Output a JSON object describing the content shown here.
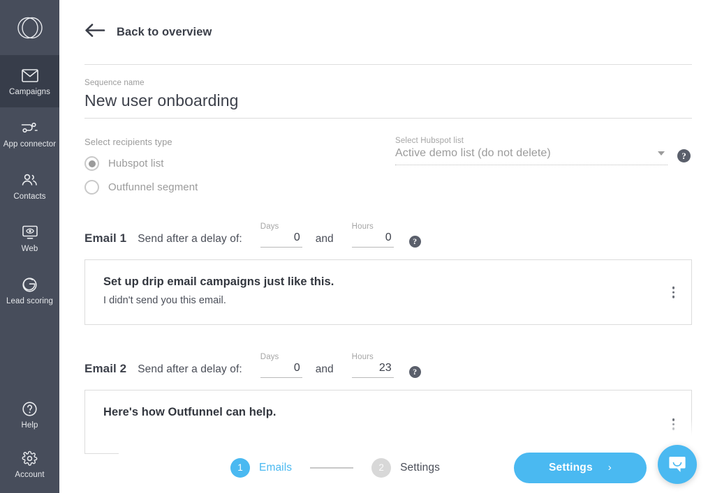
{
  "sidebar": {
    "logo_name": "outfunnel-logo",
    "items": [
      {
        "label": "Campaigns",
        "icon": "envelope-icon",
        "active": true
      },
      {
        "label": "App connector",
        "icon": "connector-icon",
        "active": false
      },
      {
        "label": "Contacts",
        "icon": "contacts-icon",
        "active": false
      },
      {
        "label": "Web",
        "icon": "monitor-eye-icon",
        "active": false
      },
      {
        "label": "Lead scoring",
        "icon": "target-icon",
        "active": false
      }
    ],
    "bottom_items": [
      {
        "label": "Help",
        "icon": "question-circle-icon"
      },
      {
        "label": "Account",
        "icon": "gear-icon"
      }
    ]
  },
  "header": {
    "back_label": "Back to overview",
    "back_icon": "arrow-left-icon"
  },
  "sequence": {
    "name_caption": "Sequence name",
    "name_value": "New user onboarding"
  },
  "recipients": {
    "type_label": "Select recipients type",
    "options": [
      {
        "label": "Hubspot list",
        "selected": true
      },
      {
        "label": "Outfunnel segment",
        "selected": false
      }
    ],
    "list_caption": "Select Hubspot list",
    "list_value": "Active demo list (do not delete)",
    "caret_icon": "chevron-down-icon",
    "help_icon": "question-circle-icon"
  },
  "emails": [
    {
      "title": "Email 1",
      "delay_text": "Send after a delay of:",
      "days_caption": "Days",
      "days_value": "0",
      "and_text": "and",
      "hours_caption": "Hours",
      "hours_value": "0",
      "help_icon": "question-circle-icon",
      "subject": "Set up drip email campaigns just like this.",
      "preview": "I didn't send you this email.",
      "menu_icon": "kebab-menu-icon"
    },
    {
      "title": "Email 2",
      "delay_text": "Send after a delay of:",
      "days_caption": "Days",
      "days_value": "0",
      "and_text": "and",
      "hours_caption": "Hours",
      "hours_value": "23",
      "help_icon": "question-circle-icon",
      "subject": "Here's how Outfunnel can help.",
      "preview": "",
      "menu_icon": "kebab-menu-icon"
    }
  ],
  "footer": {
    "steps": [
      {
        "num": "1",
        "label": "Emails",
        "active": true
      },
      {
        "num": "2",
        "label": "Settings",
        "active": false
      }
    ],
    "primary_button": "Settings",
    "primary_button_chevron": "chevron-right-icon",
    "chat_icon": "chat-bubble-icon"
  },
  "colors": {
    "accent": "#4ab9f1",
    "sidebar_bg": "#474d5b",
    "sidebar_active_bg": "#373d4a",
    "text_dark": "#3d414b",
    "text_muted": "#9b9b9b"
  }
}
